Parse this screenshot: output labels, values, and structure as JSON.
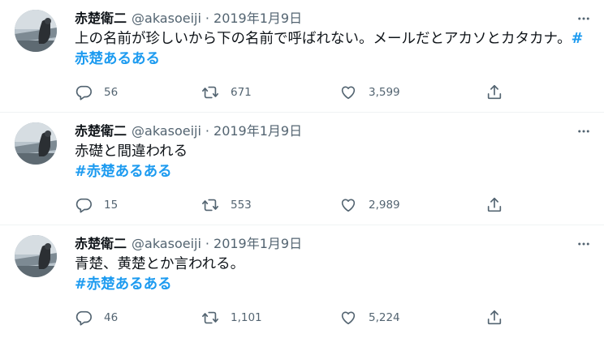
{
  "tweets": [
    {
      "display_name": "赤楚衛二",
      "handle": "@akasoeiji",
      "separator": "·",
      "date": "2019年1月9日",
      "text": "上の名前が珍しいから下の名前で呼ばれない。メールだとアカソとカタカナ。",
      "hashtag": "#赤楚あるある",
      "hashtag_inline": true,
      "counts": {
        "replies": "56",
        "retweets": "671",
        "likes": "3,599"
      }
    },
    {
      "display_name": "赤楚衛二",
      "handle": "@akasoeiji",
      "separator": "·",
      "date": "2019年1月9日",
      "text": "赤礎と間違われる",
      "hashtag": "#赤楚あるある",
      "hashtag_inline": false,
      "counts": {
        "replies": "15",
        "retweets": "553",
        "likes": "2,989"
      }
    },
    {
      "display_name": "赤楚衛二",
      "handle": "@akasoeiji",
      "separator": "·",
      "date": "2019年1月9日",
      "text": "青楚、黄楚とか言われる。",
      "hashtag": "#赤楚あるある",
      "hashtag_inline": false,
      "counts": {
        "replies": "46",
        "retweets": "1,101",
        "likes": "5,224"
      }
    }
  ],
  "icons": {
    "reply": "reply-icon",
    "retweet": "retweet-icon",
    "like": "heart-icon",
    "share": "share-icon",
    "more": "more-icon"
  },
  "colors": {
    "text": "#0f1419",
    "muted": "#536471",
    "hashtag": "#1d9bf0",
    "divider": "#eff3f4"
  }
}
